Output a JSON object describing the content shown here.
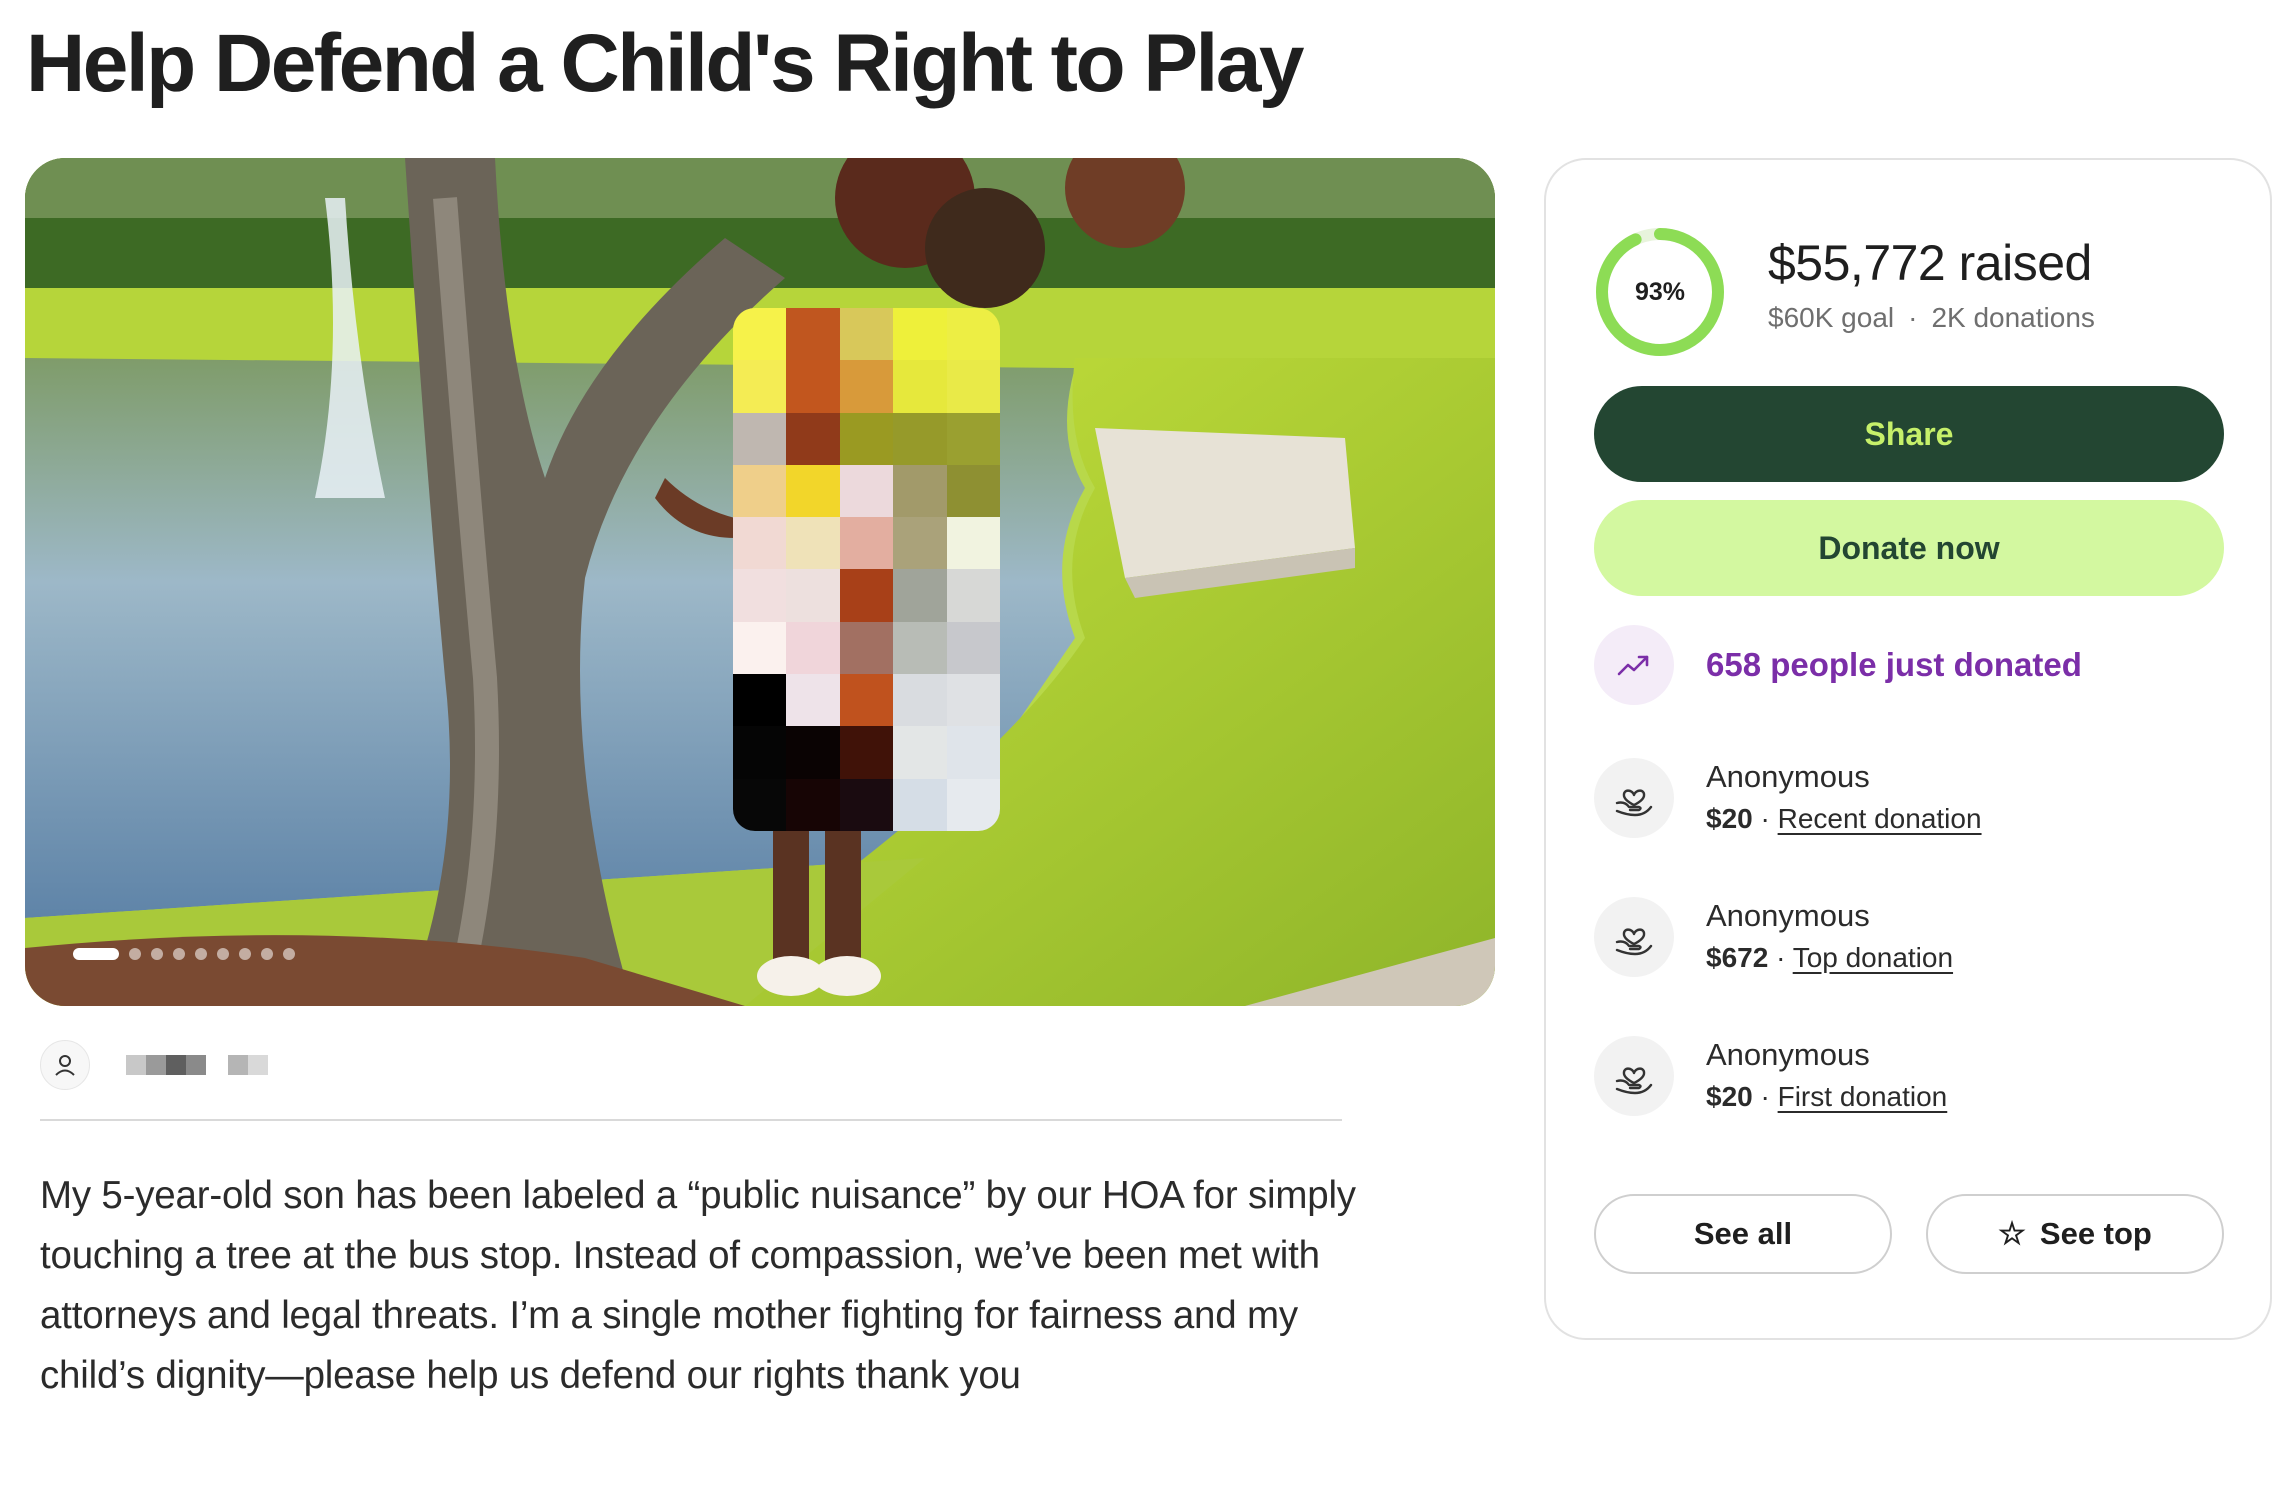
{
  "page": {
    "title": "Help Defend a Child's Right to Play"
  },
  "organizer": {
    "avatar_icon": "user-icon"
  },
  "story": {
    "text": "My 5-year-old son has been labeled a “public nuisance” by our HOA for simply touching a tree at the bus stop. Instead of compassion, we’ve been met with attorneys and legal threats. I’m a single mother fighting for fairness and my child’s dignity—please help us defend our rights thank you"
  },
  "carousel": {
    "prev_icon": "arrow-left-icon",
    "next_icon": "arrow-right-icon",
    "prev_glyph": "←",
    "next_glyph": "→",
    "slide_count": 9,
    "active_index": 0
  },
  "fundraiser": {
    "progress_percent": 93,
    "progress_label": "93%",
    "raised": "$55,772 raised",
    "goal": "$60K goal",
    "separator": "·",
    "donations": "2K donations",
    "share_label": "Share",
    "donate_label": "Donate now",
    "trend_icon": "trending-up-icon",
    "trend_text": "658 people just donated",
    "accent_dark": "#234632",
    "accent_light": "#d3f8a0",
    "ring_color": "#8ddc55",
    "trend_color": "#7b2ea8"
  },
  "donors": [
    {
      "name": "Anonymous",
      "amount": "$20",
      "dot": "·",
      "type": "Recent donation",
      "icon": "heart-hand-icon"
    },
    {
      "name": "Anonymous",
      "amount": "$672",
      "dot": "·",
      "type": "Top donation",
      "icon": "heart-hand-icon"
    },
    {
      "name": "Anonymous",
      "amount": "$20",
      "dot": "·",
      "type": "First donation",
      "icon": "heart-hand-icon"
    }
  ],
  "actions": {
    "see_all": "See all",
    "see_top": "See top",
    "star_icon": "star-icon",
    "star_glyph": "☆"
  }
}
